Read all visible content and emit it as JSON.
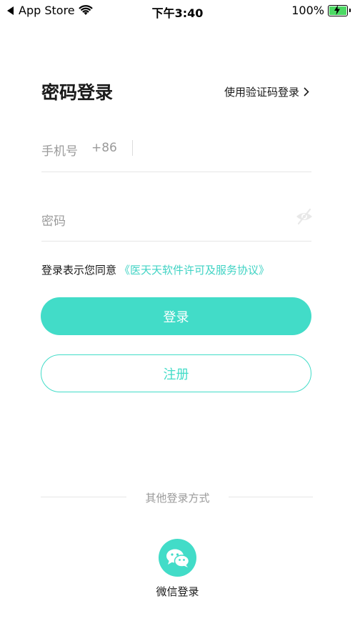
{
  "status_bar": {
    "back_app": "App Store",
    "time": "下午3:40",
    "battery": "100%"
  },
  "login": {
    "title": "密码登录",
    "switch_label": "使用验证码登录",
    "phone_label": "手机号",
    "country_code": "+86",
    "phone_value": "",
    "password_label": "密码",
    "password_value": "",
    "agreement_prefix": "登录表示您同意",
    "agreement_link": "《医天天软件许可及服务协议》",
    "login_button": "登录",
    "register_button": "注册"
  },
  "other_login": {
    "title": "其他登录方式",
    "wechat_label": "微信登录"
  },
  "colors": {
    "accent": "#42dcc8",
    "link": "#40d3c4",
    "battery": "#4cd964"
  }
}
